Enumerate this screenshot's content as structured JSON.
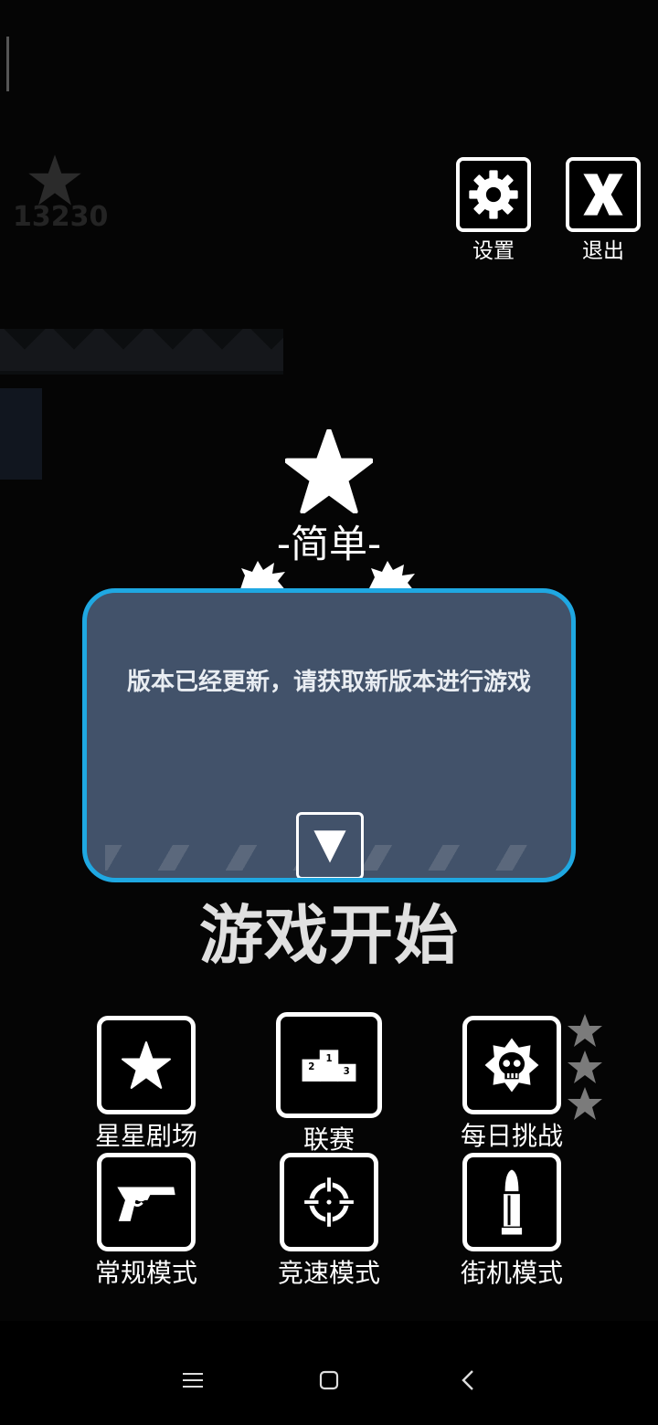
{
  "header": {
    "score": "13230",
    "settings_label": "设置",
    "exit_label": "退出"
  },
  "difficulty": {
    "label": "-简单-"
  },
  "dialog": {
    "message": "版本已经更新，请获取新版本进行游戏"
  },
  "start_title": "游戏开始",
  "modes": {
    "star_theater": "星星剧场",
    "league": "联赛",
    "daily_challenge": "每日挑战",
    "classic": "常规模式",
    "speed": "竞速模式",
    "arcade": "街机模式"
  },
  "icons": {
    "settings": "gear-icon",
    "exit": "x-icon",
    "ok": "triangle-down-icon",
    "star_theater": "star-icon",
    "league": "podium-icon",
    "daily_challenge": "skull-badge-icon",
    "classic": "revolver-icon",
    "speed": "crosshair-icon",
    "arcade": "bullet-icon"
  },
  "colors": {
    "dialog_border": "#1fa8e2",
    "dialog_bg": "#42526a",
    "background": "#050505"
  }
}
